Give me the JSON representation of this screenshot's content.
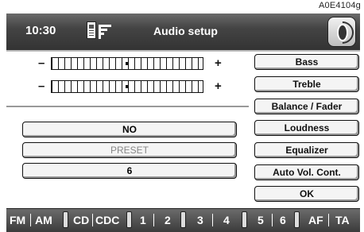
{
  "figure_code": "A0E4104g",
  "header": {
    "time": "10:30",
    "title": "Audio setup",
    "icons": [
      "phone-icon",
      "document-icon",
      "speaker-icon"
    ]
  },
  "sliders": [
    {
      "minus": "–",
      "plus": "+",
      "level": 0.5
    },
    {
      "minus": "–",
      "plus": "+",
      "level": 0.5
    }
  ],
  "values": {
    "loudness_value": "NO",
    "equalizer_value": "PRESET",
    "auto_vol_value": "6"
  },
  "menu": [
    "Bass",
    "Treble",
    "Balance / Fader",
    "Loudness",
    "Equalizer",
    "Auto Vol. Cont.",
    "OK"
  ],
  "sources": [
    "FM",
    "AM",
    "CD",
    "CDC",
    "1",
    "2",
    "3",
    "4",
    "5",
    "6",
    "AF",
    "TA"
  ]
}
